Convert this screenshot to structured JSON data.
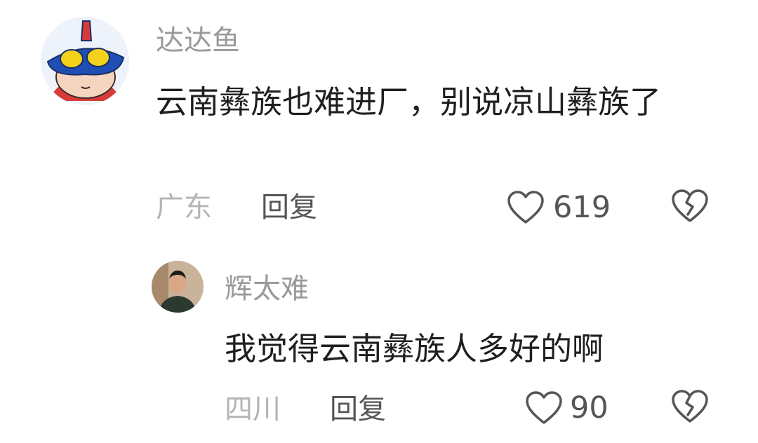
{
  "comments": [
    {
      "username": "达达鱼",
      "content": "云南彝族也难进厂，别说凉山彝族了",
      "location": "广东",
      "reply_label": "回复",
      "likes": "619",
      "icons": {
        "avatar": "cartoon-hero-avatar",
        "like": "heart-outline-icon",
        "dislike": "broken-heart-icon"
      }
    },
    {
      "username": "辉太难",
      "content": "我觉得云南彝族人多好的啊",
      "location": "四川",
      "reply_label": "回复",
      "likes": "90",
      "icons": {
        "avatar": "man-photo-avatar",
        "like": "heart-outline-icon",
        "dislike": "broken-heart-icon"
      }
    }
  ],
  "colors": {
    "username": "#9a9a9a",
    "content": "#1f1f1f",
    "location": "#b4b4b4",
    "reply": "#555555",
    "icon_stroke": "#555555"
  }
}
